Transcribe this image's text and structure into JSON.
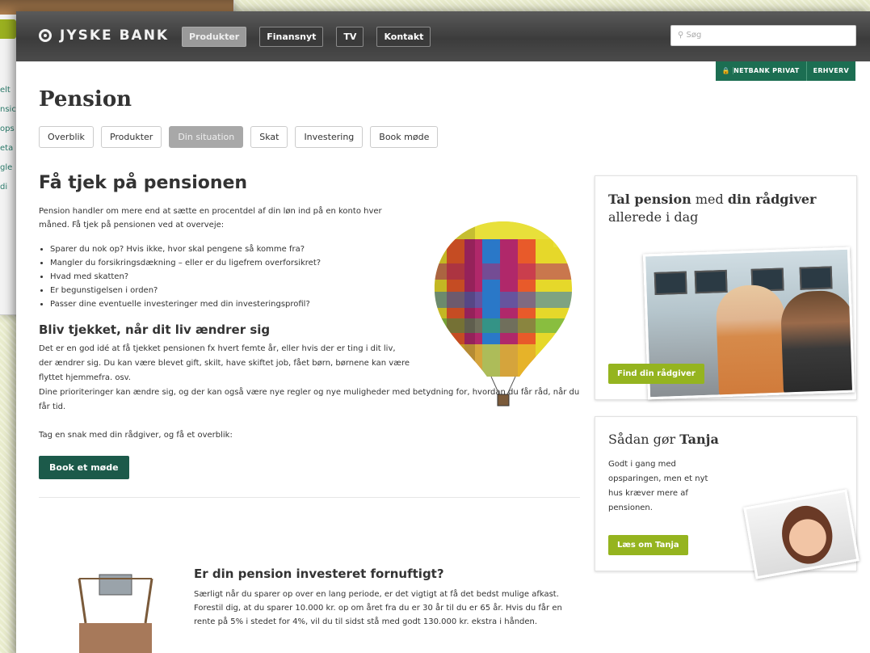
{
  "background_window": {
    "side_fragments": [
      "elt",
      "nsic",
      "ops",
      "eta",
      "gle",
      "di"
    ]
  },
  "header": {
    "logo_text": "JYSKE BANK",
    "nav": [
      "Produkter",
      "Finansnyt",
      "TV",
      "Kontakt"
    ],
    "active_nav": "Produkter",
    "search_placeholder": "Søg",
    "netbank_privat": "NETBANK PRIVAT",
    "erhverv": "ERHVERV"
  },
  "page": {
    "title": "Pension",
    "subtabs": [
      "Overblik",
      "Produkter",
      "Din situation",
      "Skat",
      "Investering",
      "Book møde"
    ],
    "active_subtab": "Din situation"
  },
  "main": {
    "heading": "Få tjek på pensionen",
    "intro": "Pension handler om mere end at sætte en procentdel af din løn ind på en konto hver måned. Få tjek på pensionen ved at overveje:",
    "checklist": [
      "Sparer du nok op? Hvis ikke, hvor skal pengene så komme fra?",
      "Mangler du forsikringsdækning – eller er du ligefrem overforsikret?",
      "Hvad med skatten?",
      "Er begunstigelsen i orden?",
      "Passer dine eventuelle investeringer med din investeringsprofil?"
    ],
    "sub_heading": "Bliv tjekket, når dit liv ændrer sig",
    "body1": "Det er en god idé at få tjekket pensionen fx hvert femte år, eller hvis der er ting i dit liv, der ændrer sig. Du kan være blevet gift, skilt, have skiftet job, fået børn, børnene kan være flyttet hjemmefra. osv.",
    "body2": "Dine prioriteringer kan ændre sig, og der kan også være nye regler og nye muligheder med betydning for, hvordan du får råd, når du får tid.",
    "cta_text": "Tag en snak med din rådgiver, og få et overblik:",
    "book_button": "Book et møde"
  },
  "teaser": {
    "heading": "Er din pension investeret fornuftigt?",
    "text": "Særligt når du sparer op over en lang periode, er det vigtigt at få det bedst mulige afkast. Forestil dig, at du sparer 10.000 kr. op om året fra du er 30 år til du er 65 år. Hvis du får en rente på 5% i stedet for 4%, vil du til sidst stå med godt 130.000 kr. ekstra i hånden."
  },
  "sidebar": {
    "card1": {
      "title_bold1": "Tal pension",
      "title_light1": " med ",
      "title_bold2": "din rådgiver",
      "title_line2": "allerede i dag",
      "button": "Find din rådgiver"
    },
    "card2": {
      "title_light": "Sådan gør ",
      "title_bold": "Tanja",
      "text": "Godt i gang med opsparingen, men et nyt hus kræver mere af pensionen.",
      "button": "Læs om Tanja"
    }
  },
  "colors": {
    "topbar": "#444444",
    "netbank_green": "#1c6e52",
    "book_green": "#1c5a4a",
    "lime_button": "#95b41f"
  }
}
